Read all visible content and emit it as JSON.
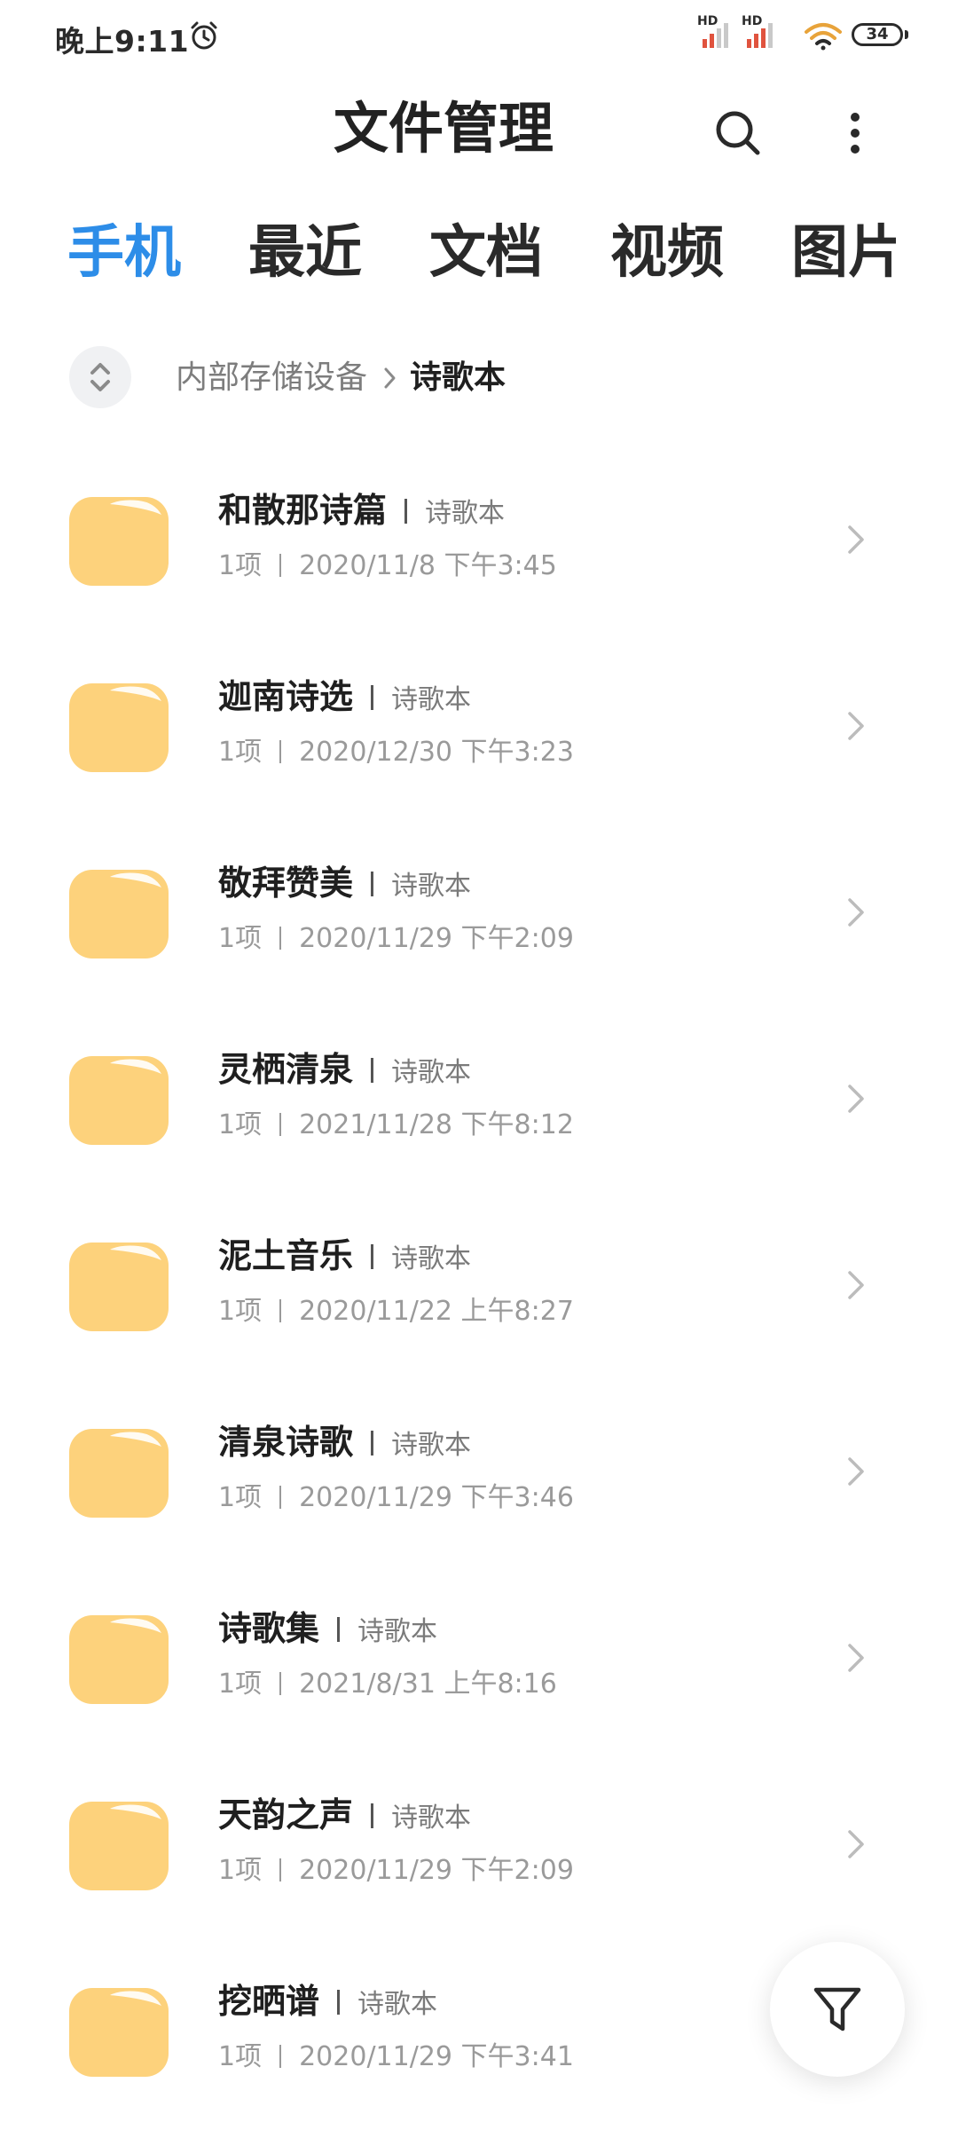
{
  "status_bar": {
    "time": "晚上9:11",
    "signal_label": "HD",
    "battery": "34"
  },
  "header": {
    "title": "文件管理"
  },
  "tabs": [
    {
      "label": "手机",
      "active": true
    },
    {
      "label": "最近",
      "active": false
    },
    {
      "label": "文档",
      "active": false
    },
    {
      "label": "视频",
      "active": false
    },
    {
      "label": "图片",
      "active": false
    }
  ],
  "breadcrumb": {
    "parent": "内部存储设备",
    "current": "诗歌本"
  },
  "colors": {
    "accent": "#2d8de8",
    "folder": "#fdd27c"
  },
  "folders": [
    {
      "name": "和散那诗篇",
      "parent": "诗歌本",
      "count": "1项",
      "date": "2020/11/8 下午3:45"
    },
    {
      "name": "迦南诗选",
      "parent": "诗歌本",
      "count": "1项",
      "date": "2020/12/30 下午3:23"
    },
    {
      "name": "敬拜赞美",
      "parent": "诗歌本",
      "count": "1项",
      "date": "2020/11/29 下午2:09"
    },
    {
      "name": "灵栖清泉",
      "parent": "诗歌本",
      "count": "1项",
      "date": "2021/11/28 下午8:12"
    },
    {
      "name": "泥土音乐",
      "parent": "诗歌本",
      "count": "1项",
      "date": "2020/11/22 上午8:27"
    },
    {
      "name": "清泉诗歌",
      "parent": "诗歌本",
      "count": "1项",
      "date": "2020/11/29 下午3:46"
    },
    {
      "name": "诗歌集",
      "parent": "诗歌本",
      "count": "1项",
      "date": "2021/8/31 上午8:16"
    },
    {
      "name": "天韵之声",
      "parent": "诗歌本",
      "count": "1项",
      "date": "2020/11/29 下午2:09"
    },
    {
      "name": "挖晒谱",
      "parent": "诗歌本",
      "count": "1项",
      "date": "2020/11/29 下午3:41"
    }
  ],
  "icons": {
    "alarm": "alarm-icon",
    "wifi": "wifi-icon",
    "search": "search-icon",
    "more": "more-vertical-icon",
    "sort": "sort-icon",
    "folder": "folder-icon",
    "chevron": "chevron-right-icon",
    "filter": "filter-icon"
  }
}
